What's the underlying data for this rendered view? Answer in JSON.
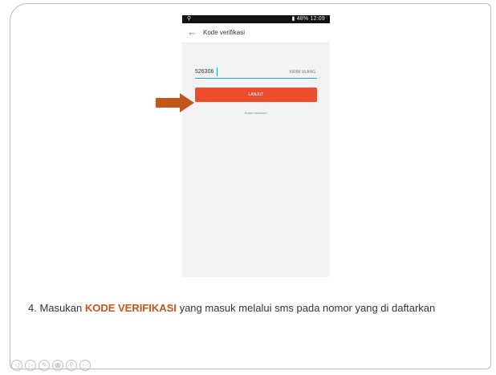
{
  "status_bar": {
    "left_icon": "usb-icon",
    "right_text": "48% 12:09"
  },
  "app_header": {
    "back_icon": "back-arrow-icon",
    "title": "Kode verifikasi"
  },
  "form": {
    "code_value": "526306",
    "resend_label": "KIRIM ULANG",
    "submit_label": "LANJUT",
    "help_link": "Butuh bantuan?"
  },
  "instruction": {
    "prefix": "4. Masukan ",
    "highlight": "KODE VERIFIKASI",
    "suffix": "  yang masuk melalui sms pada nomor yang di daftarkan"
  },
  "colors": {
    "accent": "#ee4d2d",
    "back_arrow": "#ee5a24",
    "pointer": "#c0561b",
    "highlight": "#c0561b",
    "input_underline": "#26a8c0"
  },
  "toolbar": [
    {
      "icon": "navigate-icon",
      "glyph": "◁"
    },
    {
      "icon": "play-icon",
      "glyph": "▷"
    },
    {
      "icon": "pen-icon",
      "glyph": "✎"
    },
    {
      "icon": "slides-icon",
      "glyph": "▦"
    },
    {
      "icon": "zoom-icon",
      "glyph": "⚲"
    },
    {
      "icon": "more-icon",
      "glyph": "⋯"
    }
  ]
}
